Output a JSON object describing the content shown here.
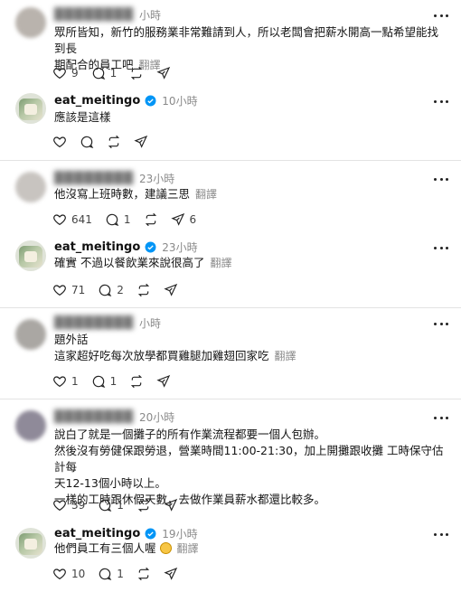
{
  "icons": {
    "like": "heart-outline-icon",
    "reply": "speech-bubble-icon",
    "repost": "repost-arrows-icon",
    "share": "paper-plane-icon",
    "verified": "verified-badge-icon",
    "more": "more-dots-icon"
  },
  "colors": {
    "verified": "#0095f6",
    "muted": "#8a8a8a",
    "text": "#111111"
  },
  "translate_label": "翻譯",
  "posts": [
    {
      "user": "████████",
      "time": "小時",
      "lines": [
        "眾所皆知，新竹的服務業非常難請到人，所以老闆會把薪水開高一點希望能找到長",
        "期配合的員工吧"
      ],
      "likes": "9",
      "replies": "1",
      "reposts": "",
      "shares": ""
    },
    {
      "user": "eat_meitingo",
      "time": "10小時",
      "lines": [
        "應該是這樣"
      ],
      "likes": "",
      "replies": "",
      "reposts": "",
      "shares": ""
    },
    {
      "user": "████████",
      "time": "23小時",
      "lines": [
        "他沒寫上班時數，建議三思"
      ],
      "likes": "641",
      "replies": "1",
      "reposts": "",
      "shares": "6"
    },
    {
      "user": "eat_meitingo",
      "time": "23小時",
      "lines": [
        "確實 不過以餐飲業來說很高了"
      ],
      "likes": "71",
      "replies": "2",
      "reposts": "",
      "shares": ""
    },
    {
      "user": "████████",
      "time": "小時",
      "lines": [
        "題外話",
        "這家超好吃每次放學都買雞腿加雞翅回家吃"
      ],
      "likes": "1",
      "replies": "1",
      "reposts": "",
      "shares": ""
    },
    {
      "user": "████████",
      "time": "20小時",
      "lines": [
        "說白了就是一個攤子的所有作業流程都要一個人包辦。",
        "然後沒有勞健保跟勞退，營業時間11:00-21:30，加上開攤跟收攤 工時保守估計每",
        "天12-13個小時以上。",
        "一樣的工時跟休假天數，去做作業員薪水都還比較多。"
      ],
      "likes": "39",
      "replies": "1",
      "reposts": "",
      "shares": ""
    },
    {
      "user": "eat_meitingo",
      "time": "19小時",
      "lines": [
        "他們員工有三個人喔"
      ],
      "likes": "10",
      "replies": "1",
      "reposts": "",
      "shares": ""
    }
  ]
}
